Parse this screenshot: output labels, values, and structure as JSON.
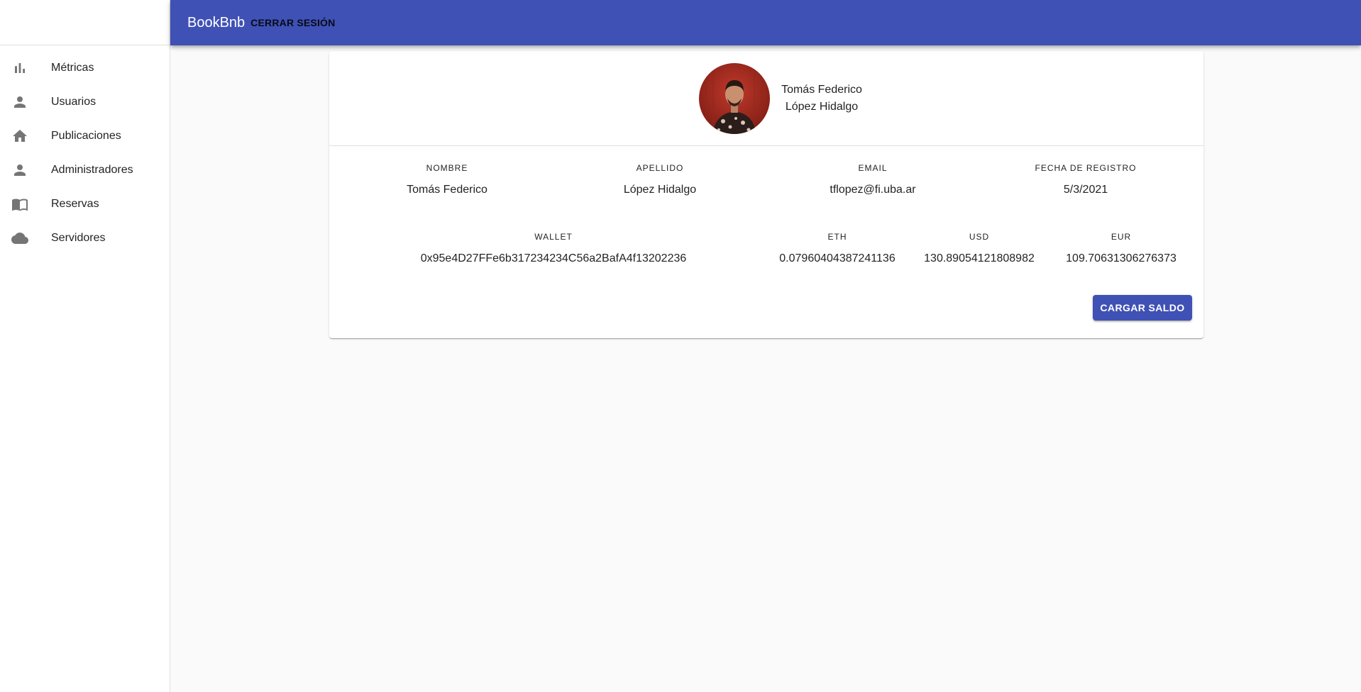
{
  "appbar": {
    "title": "BookBnb",
    "logout_label": "CERRAR SESIÓN",
    "color": "#3f51b5"
  },
  "sidebar": {
    "items": [
      {
        "label": "Métricas",
        "icon": "bar-chart-icon"
      },
      {
        "label": "Usuarios",
        "icon": "person-icon"
      },
      {
        "label": "Publicaciones",
        "icon": "home-icon"
      },
      {
        "label": "Administradores",
        "icon": "person-icon"
      },
      {
        "label": "Reservas",
        "icon": "book-icon"
      },
      {
        "label": "Servidores",
        "icon": "cloud-icon"
      }
    ]
  },
  "profile": {
    "header_first": "Tomás Federico",
    "header_last": "López Hidalgo",
    "fields": {
      "nombre": {
        "label": "NOMBRE",
        "value": "Tomás Federico"
      },
      "apellido": {
        "label": "APELLIDO",
        "value": "López Hidalgo"
      },
      "email": {
        "label": "EMAIL",
        "value": "tflopez@fi.uba.ar"
      },
      "fecha": {
        "label": "FECHA DE REGISTRO",
        "value": "5/3/2021"
      },
      "wallet": {
        "label": "WALLET",
        "value": "0x95e4D27FFe6b317234234C56a2BafA4f13202236"
      },
      "eth": {
        "label": "ETH",
        "value": "0.07960404387241136"
      },
      "usd": {
        "label": "USD",
        "value": "130.89054121808982"
      },
      "eur": {
        "label": "EUR",
        "value": "109.70631306276373"
      }
    },
    "load_button_label": "CARGAR SALDO"
  }
}
